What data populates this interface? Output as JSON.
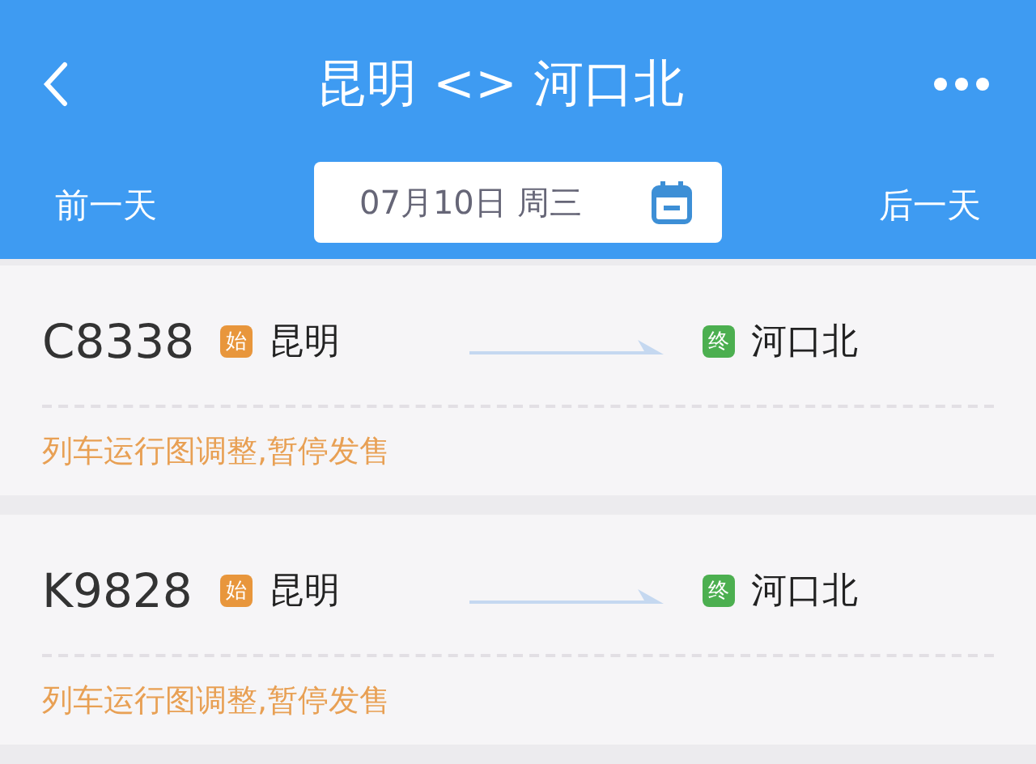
{
  "header": {
    "title": "昆明 <> 河口北",
    "prev_day": "前一天",
    "date": "07月10日 周三",
    "next_day": "后一天"
  },
  "trains": [
    {
      "number": "C8338",
      "origin": {
        "badge": "始",
        "station": "昆明",
        "color": "#e8963c"
      },
      "destination": {
        "badge": "终",
        "station": "河口北",
        "color": "#4caf50"
      },
      "notice": "列车运行图调整,暂停发售"
    },
    {
      "number": "K9828",
      "origin": {
        "badge": "始",
        "station": "昆明",
        "color": "#e8963c"
      },
      "destination": {
        "badge": "终",
        "station": "河口北",
        "color": "#4caf50"
      },
      "notice": "列车运行图调整,暂停发售"
    }
  ]
}
